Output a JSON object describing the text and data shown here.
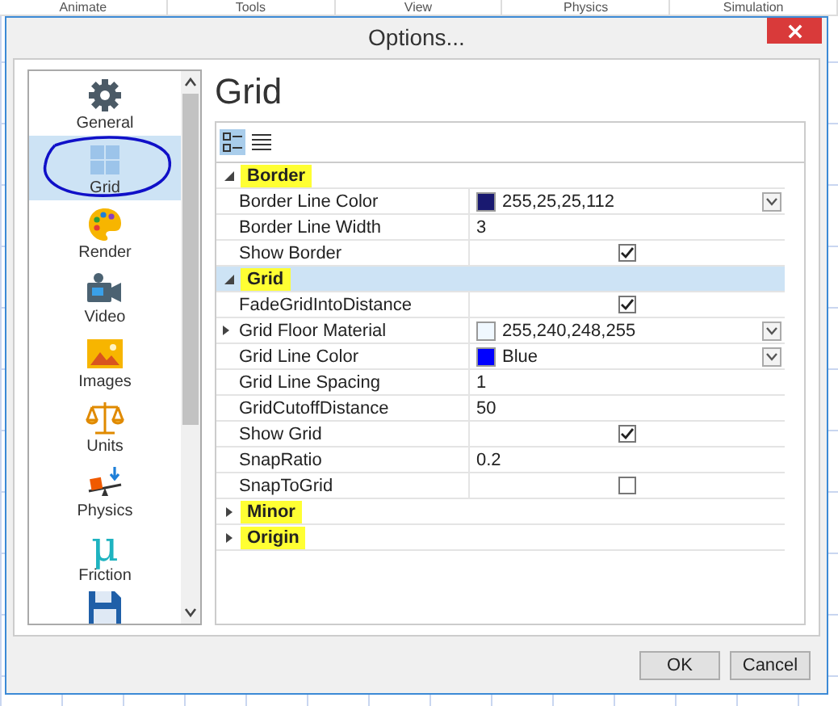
{
  "background_menu": [
    "Animate",
    "Tools",
    "View",
    "Physics",
    "Simulation"
  ],
  "dialog": {
    "title": "Options..."
  },
  "sidebar": {
    "items": [
      {
        "label": "General",
        "selected": false,
        "annotated": false
      },
      {
        "label": "Grid",
        "selected": true,
        "annotated": true
      },
      {
        "label": "Render",
        "selected": false,
        "annotated": false
      },
      {
        "label": "Video",
        "selected": false,
        "annotated": false
      },
      {
        "label": "Images",
        "selected": false,
        "annotated": false
      },
      {
        "label": "Units",
        "selected": false,
        "annotated": false
      },
      {
        "label": "Physics",
        "selected": false,
        "annotated": false
      },
      {
        "label": "Friction",
        "glyph": "μ",
        "selected": false,
        "annotated": false
      },
      {
        "selected": false,
        "annotated": false
      }
    ]
  },
  "heading": "Grid",
  "property_grid": {
    "view_buttons": [
      {
        "selected": true
      },
      {
        "selected": false
      }
    ],
    "categories": [
      {
        "name": "Border",
        "expanded": true,
        "highlighted": true,
        "selected": false,
        "properties": [
          {
            "name": "Border Line Color",
            "kind": "color",
            "value": "255,25,25,112",
            "color": "#191970"
          },
          {
            "name": "Border Line Width",
            "kind": "text",
            "value": "3"
          },
          {
            "name": "Show Border",
            "kind": "check",
            "checked": true
          }
        ]
      },
      {
        "name": "Grid",
        "expanded": true,
        "highlighted": true,
        "selected": true,
        "properties": [
          {
            "name": "FadeGridIntoDistance",
            "kind": "check",
            "checked": true
          },
          {
            "name": "Grid Floor Material",
            "kind": "color",
            "value": "255,240,248,255",
            "color": "#f0f8ff",
            "expandable": true
          },
          {
            "name": "Grid Line Color",
            "kind": "color",
            "value": "Blue",
            "color": "#0000ff"
          },
          {
            "name": "Grid Line Spacing",
            "kind": "text",
            "value": "1"
          },
          {
            "name": "GridCutoffDistance",
            "kind": "text",
            "value": "50"
          },
          {
            "name": "Show Grid",
            "kind": "check",
            "checked": true
          },
          {
            "name": "SnapRatio",
            "kind": "text",
            "value": "0.2"
          },
          {
            "name": "SnapToGrid",
            "kind": "check",
            "checked": false
          }
        ]
      },
      {
        "name": "Minor",
        "expanded": false,
        "highlighted": true,
        "selected": false
      },
      {
        "name": "Origin",
        "expanded": false,
        "highlighted": true,
        "selected": false
      }
    ]
  },
  "buttons": [
    "OK",
    "Cancel"
  ]
}
